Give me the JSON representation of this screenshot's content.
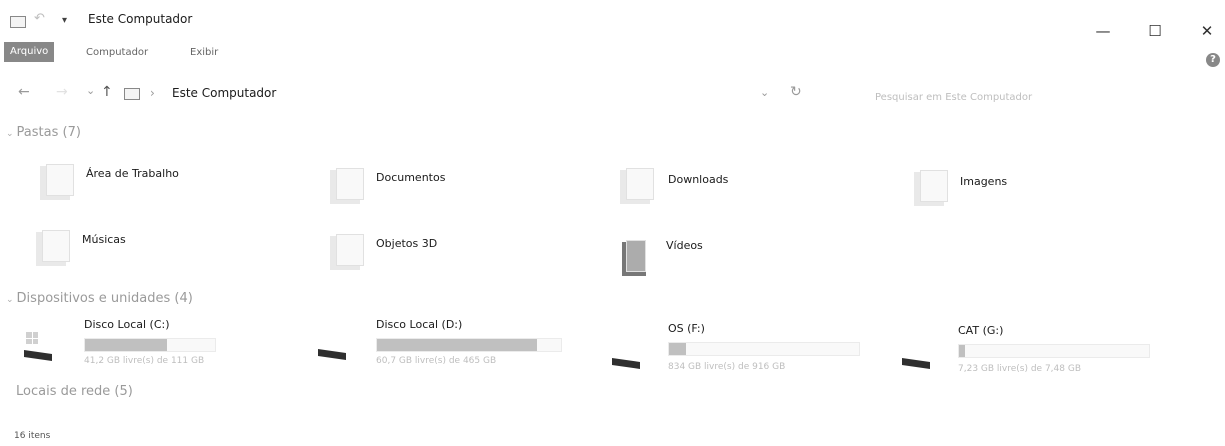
{
  "window": {
    "title": "Este Computador",
    "controls": {
      "minimize": "—",
      "maximize": "☐",
      "close": "✕"
    }
  },
  "quick_access": {
    "dropdown": "▾",
    "undo": "↶"
  },
  "ribbon": {
    "tabs": [
      {
        "label": "Arquivo",
        "active": true
      },
      {
        "label": "Computador"
      },
      {
        "label": "Exibir"
      }
    ],
    "help": "?"
  },
  "address_bar": {
    "back": "←",
    "forward": "→",
    "recent": "⌄",
    "up": "↑",
    "separator": "›",
    "path": "Este Computador",
    "dropdown": "⌄",
    "refresh": "↻",
    "search_placeholder": "Pesquisar em Este Computador"
  },
  "groups": {
    "folders": {
      "title": "Pastas (7)",
      "items": [
        {
          "label": "Área de Trabalho",
          "icon": "desktop-folder-icon"
        },
        {
          "label": "Documentos",
          "icon": "documents-folder-icon"
        },
        {
          "label": "Downloads",
          "icon": "downloads-folder-icon"
        },
        {
          "label": "Imagens",
          "icon": "pictures-folder-icon"
        },
        {
          "label": "Músicas",
          "icon": "music-folder-icon"
        },
        {
          "label": "Objetos 3D",
          "icon": "3d-objects-folder-icon"
        },
        {
          "label": "Vídeos",
          "icon": "videos-folder-icon"
        }
      ]
    },
    "devices": {
      "title": "Dispositivos e unidades (4)",
      "items": [
        {
          "name": "Disco Local (C:)",
          "free": "41,2 GB livre(s) de 111 GB",
          "used_fraction": 0.63
        },
        {
          "name": "Disco Local (D:)",
          "free": "60,7 GB livre(s) de 465 GB",
          "used_fraction": 0.87
        },
        {
          "name": "OS (F:)",
          "free": "834 GB livre(s) de 916 GB",
          "used_fraction": 0.09
        },
        {
          "name": "CAT (G:)",
          "free": "7,23 GB livre(s) de 7,48 GB",
          "used_fraction": 0.03
        }
      ]
    },
    "network": {
      "title": "Locais de rede (5)"
    }
  },
  "status_bar": {
    "count": "16 itens"
  }
}
